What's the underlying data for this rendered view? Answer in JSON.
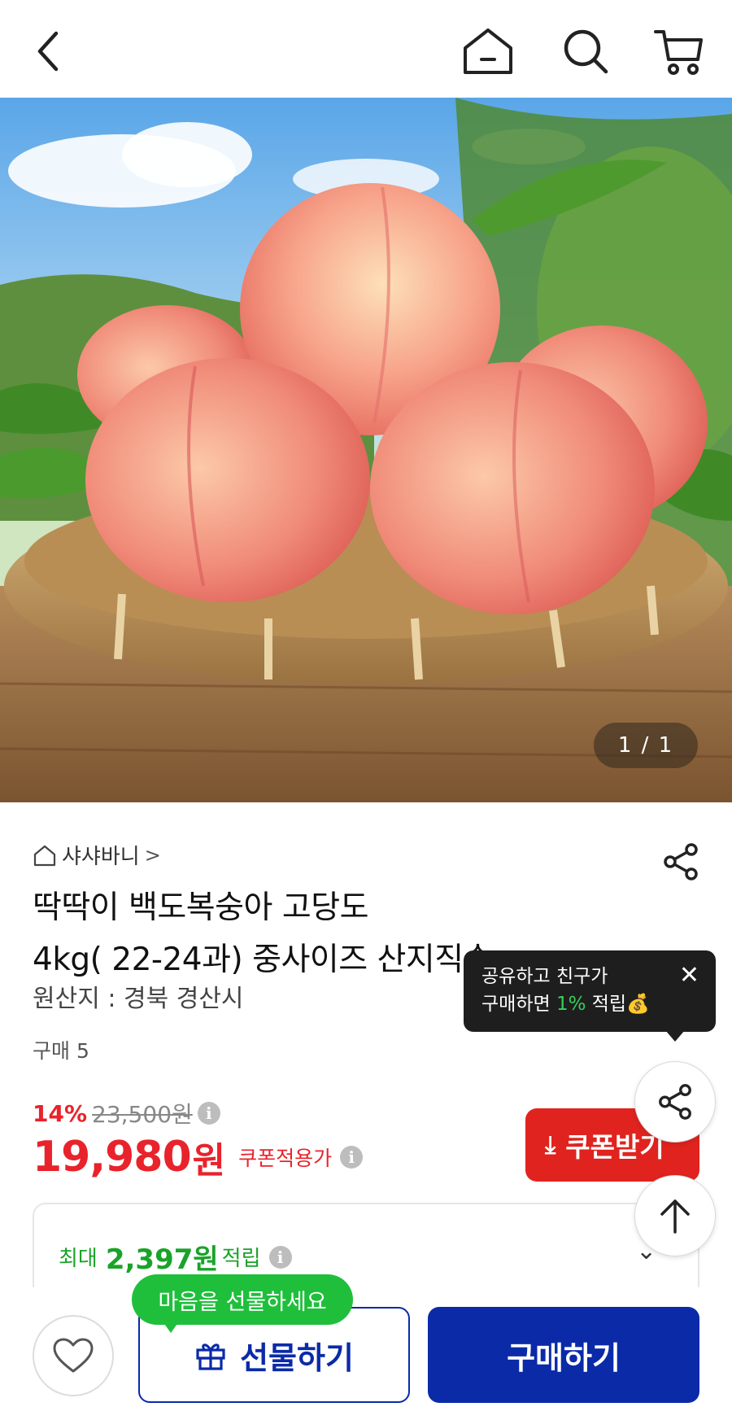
{
  "header": {
    "back_icon": "back-arrow-icon",
    "home_icon": "home-icon",
    "search_icon": "search-icon",
    "cart_icon": "cart-icon"
  },
  "gallery": {
    "counter": "1 / 1"
  },
  "product": {
    "store_name": "샤샤바니",
    "title_line1": "딱딱이 백도복숭아 고당도",
    "title_line2": "4kg( 22-24과) 중사이즈 산지직송",
    "origin": "원산지 : 경북 경산시",
    "purchase_count": "구매 5",
    "discount_rate": "14%",
    "original_price": "23,500원",
    "price_amount": "19,980",
    "price_unit": "원",
    "coupon_price_label": "쿠폰적용가",
    "coupon_button_label": "쿠폰받기",
    "points_prefix": "최대",
    "points_amount": "2,397원",
    "points_suffix": "적립"
  },
  "tooltip": {
    "line1": "공유하고 친구가",
    "line2_prefix": "구매하면 ",
    "line2_pct": "1%",
    "line2_suffix": " 적립💰",
    "close": "✕"
  },
  "bottom": {
    "gift_bubble": "마음을 선물하세요",
    "gift_button_label": "선물하기",
    "buy_button_label": "구매하기"
  },
  "colors": {
    "brand_blue": "#0a2aa8",
    "sale_red": "#e8232b",
    "points_green": "#1aa329"
  }
}
